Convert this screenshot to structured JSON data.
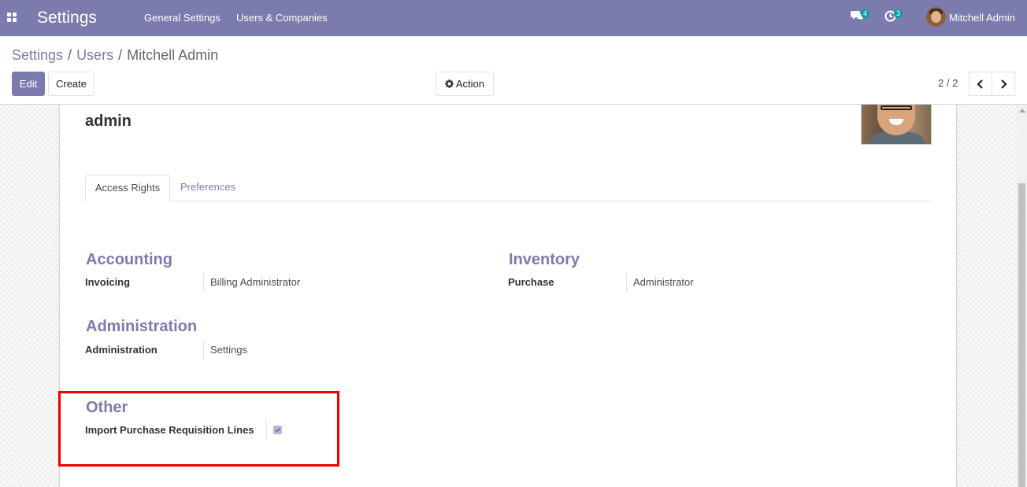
{
  "navbar": {
    "app_title": "Settings",
    "menu": [
      "General Settings",
      "Users & Companies"
    ],
    "messages_count": "4",
    "activities_count": "3",
    "user_name": "Mitchell Admin",
    "bg_color": "#7c7bad"
  },
  "breadcrumb": {
    "items": [
      "Settings",
      "Users"
    ],
    "current": "Mitchell Admin",
    "separator": "/"
  },
  "toolbar": {
    "edit_label": "Edit",
    "create_label": "Create",
    "action_label": "Action",
    "pager": "2 / 2"
  },
  "record": {
    "login": "admin",
    "tabs": [
      "Access Rights",
      "Preferences"
    ],
    "groups": {
      "accounting": {
        "title": "Accounting",
        "field_label": "Invoicing",
        "field_value": "Billing Administrator"
      },
      "inventory": {
        "title": "Inventory",
        "field_label": "Purchase",
        "field_value": "Administrator"
      },
      "administration": {
        "title": "Administration",
        "field_label": "Administration",
        "field_value": "Settings"
      },
      "other": {
        "title": "Other",
        "field_label": "Import Purchase Requisition Lines",
        "checked": true
      }
    }
  },
  "colors": {
    "accent": "#7c7bad",
    "highlight": "#ee0000"
  }
}
